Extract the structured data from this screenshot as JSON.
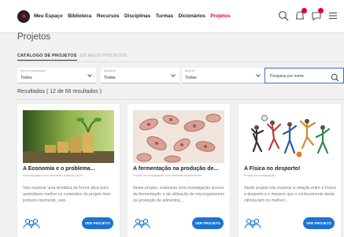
{
  "nav": {
    "items": [
      "Meu Espaço",
      "Biblioteca",
      "Recursos",
      "Disciplinas",
      "Turmas",
      "Dicionários",
      "Projetos"
    ],
    "active": "Projetos"
  },
  "page": {
    "title": "Projetos"
  },
  "tabs": [
    "CATÁLOGO DE PROJETOS",
    "OS MEUS PROJETOS"
  ],
  "filters": [
    {
      "label": "Ano de escolaridade",
      "value": "Todos"
    },
    {
      "label": "Disciplina",
      "value": "Todas"
    },
    {
      "label": "Área de",
      "value": "Todas"
    }
  ],
  "search": {
    "placeholder": "Pesquisa por nome"
  },
  "results": {
    "text": "Resultados ( 12 de 66 resultados )"
  },
  "cards": [
    {
      "title": "A Economia e o problema...",
      "subtitle": "Aprendizagem com atividades práticas (AAP)",
      "description": "Vais explorar uma temática de forma ativa para assimilares melhor os conteúdos do projeto hum primeiro momento, vais...",
      "button": "VER PROJETO"
    },
    {
      "title": "A fermentação na produção de...",
      "subtitle": "Projeto de investigação com atividade experimental",
      "description": "Neste projeto, realizarás uma investigação acerca da fermentação e da utilização de microrganismos na produção de alimentos,...",
      "button": "VER PROJETO"
    },
    {
      "title": "A Física no desporto!",
      "subtitle": "Projeto de investigação",
      "description": "Neste projeto irás explorar a relação entre a Física e desporto e o impacto que o conhecimento desta ciência tem no melhori...",
      "button": "VER PROJETO"
    }
  ],
  "colors": {
    "accent": "#e0003c",
    "button": "#1b73d4"
  },
  "icons": [
    "search-icon",
    "notifications-icon",
    "messages-icon",
    "menu-icon",
    "chevron-down-icon",
    "people-icon"
  ]
}
